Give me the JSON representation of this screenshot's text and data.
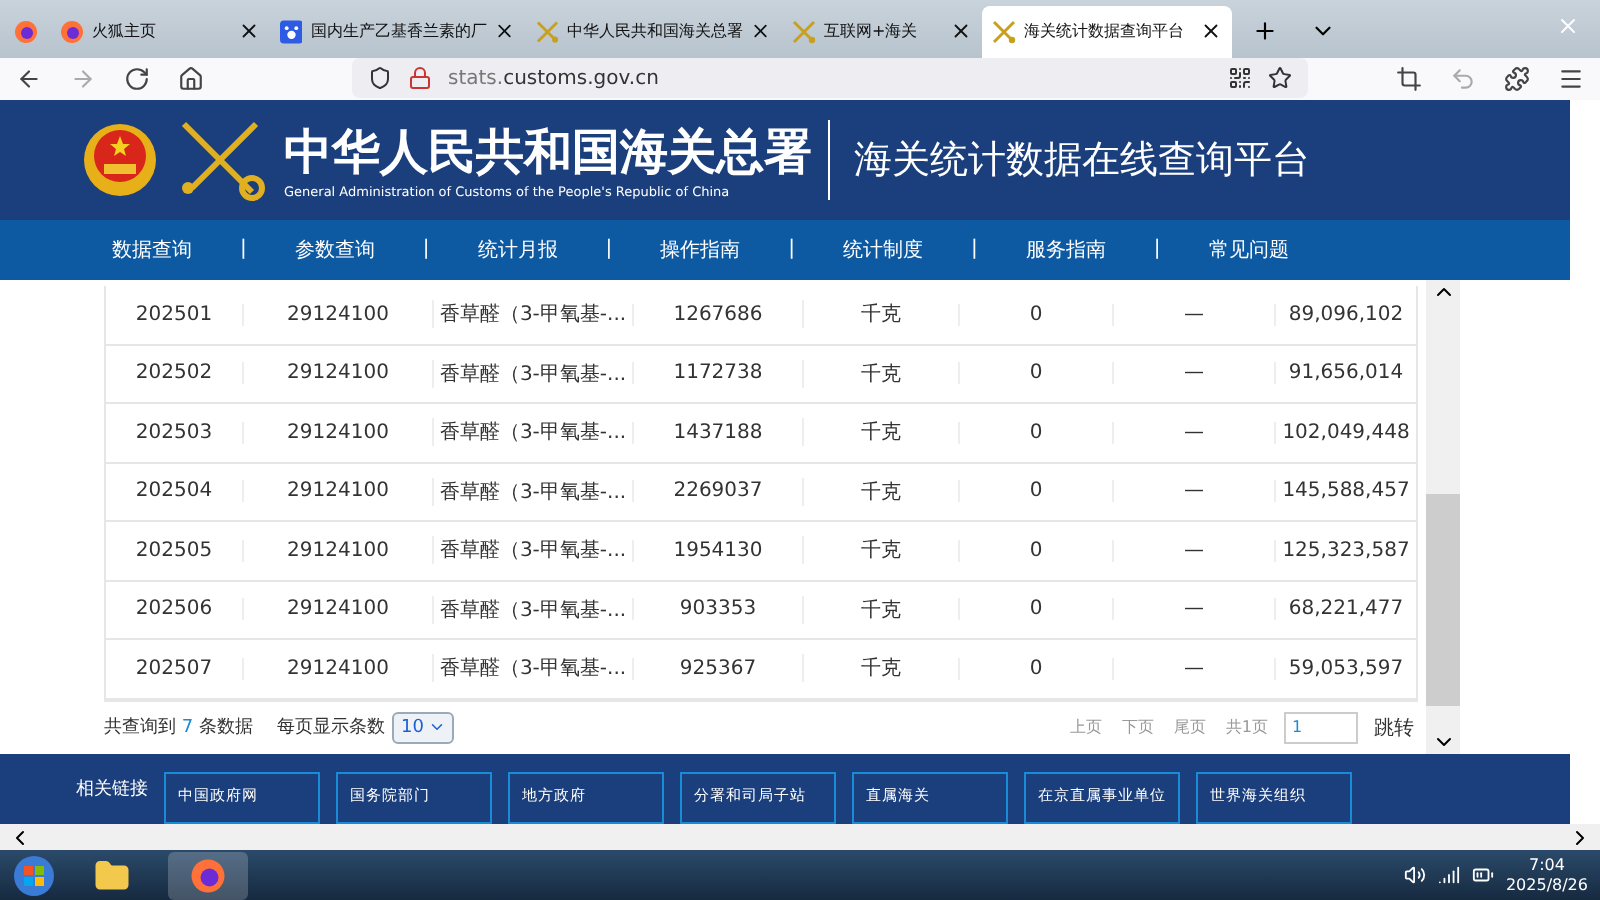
{
  "browser": {
    "tabs": [
      {
        "label": "火狐主页",
        "selected": false
      },
      {
        "label": "国内生产乙基香兰素的厂",
        "selected": false
      },
      {
        "label": "中华人民共和国海关总署",
        "selected": false
      },
      {
        "label": "互联网+海关",
        "selected": false
      },
      {
        "label": "海关统计数据查询平台",
        "selected": true
      }
    ],
    "url_host": "stats.",
    "url_domain": "customs.gov.cn"
  },
  "header": {
    "title": "中华人民共和国海关总署",
    "subtitle": "General Administration of Customs of the People's Republic of China",
    "platform": "海关统计数据在线查询平台"
  },
  "nav": {
    "separator": "|",
    "items": [
      "数据查询",
      "参数查询",
      "统计月报",
      "操作指南",
      "统计制度",
      "服务指南",
      "常见问题"
    ]
  },
  "table": {
    "rows": [
      [
        "202501",
        "29124100",
        "香草醛（3-甲氧基-...",
        "1267686",
        "千克",
        "0",
        "—",
        "89,096,102"
      ],
      [
        "202502",
        "29124100",
        "香草醛（3-甲氧基-...",
        "1172738",
        "千克",
        "0",
        "—",
        "91,656,014"
      ],
      [
        "202503",
        "29124100",
        "香草醛（3-甲氧基-...",
        "1437188",
        "千克",
        "0",
        "—",
        "102,049,448"
      ],
      [
        "202504",
        "29124100",
        "香草醛（3-甲氧基-...",
        "2269037",
        "千克",
        "0",
        "—",
        "145,588,457"
      ],
      [
        "202505",
        "29124100",
        "香草醛（3-甲氧基-...",
        "1954130",
        "千克",
        "0",
        "—",
        "125,323,587"
      ],
      [
        "202506",
        "29124100",
        "香草醛（3-甲氧基-...",
        "903353",
        "千克",
        "0",
        "—",
        "68,221,477"
      ],
      [
        "202507",
        "29124100",
        "香草醛（3-甲氧基-...",
        "925367",
        "千克",
        "0",
        "—",
        "59,053,597"
      ]
    ]
  },
  "pagination": {
    "total_prefix": "共查询到",
    "total_count": "7",
    "total_suffix": "条数据",
    "page_size_label": "每页显示条数",
    "page_size": "10",
    "links": [
      "上页",
      "下页",
      "尾页",
      "共1页"
    ],
    "page_input": "1",
    "jump": "跳转"
  },
  "footer": {
    "label": "相关链接",
    "links": [
      "中国政府网",
      "国务院部门",
      "地方政府",
      "分署和司局子站",
      "直属海关",
      "在京直属事业单位",
      "世界海关组织"
    ]
  },
  "taskbar": {
    "time": "7:04",
    "date": "2025/8/26"
  }
}
